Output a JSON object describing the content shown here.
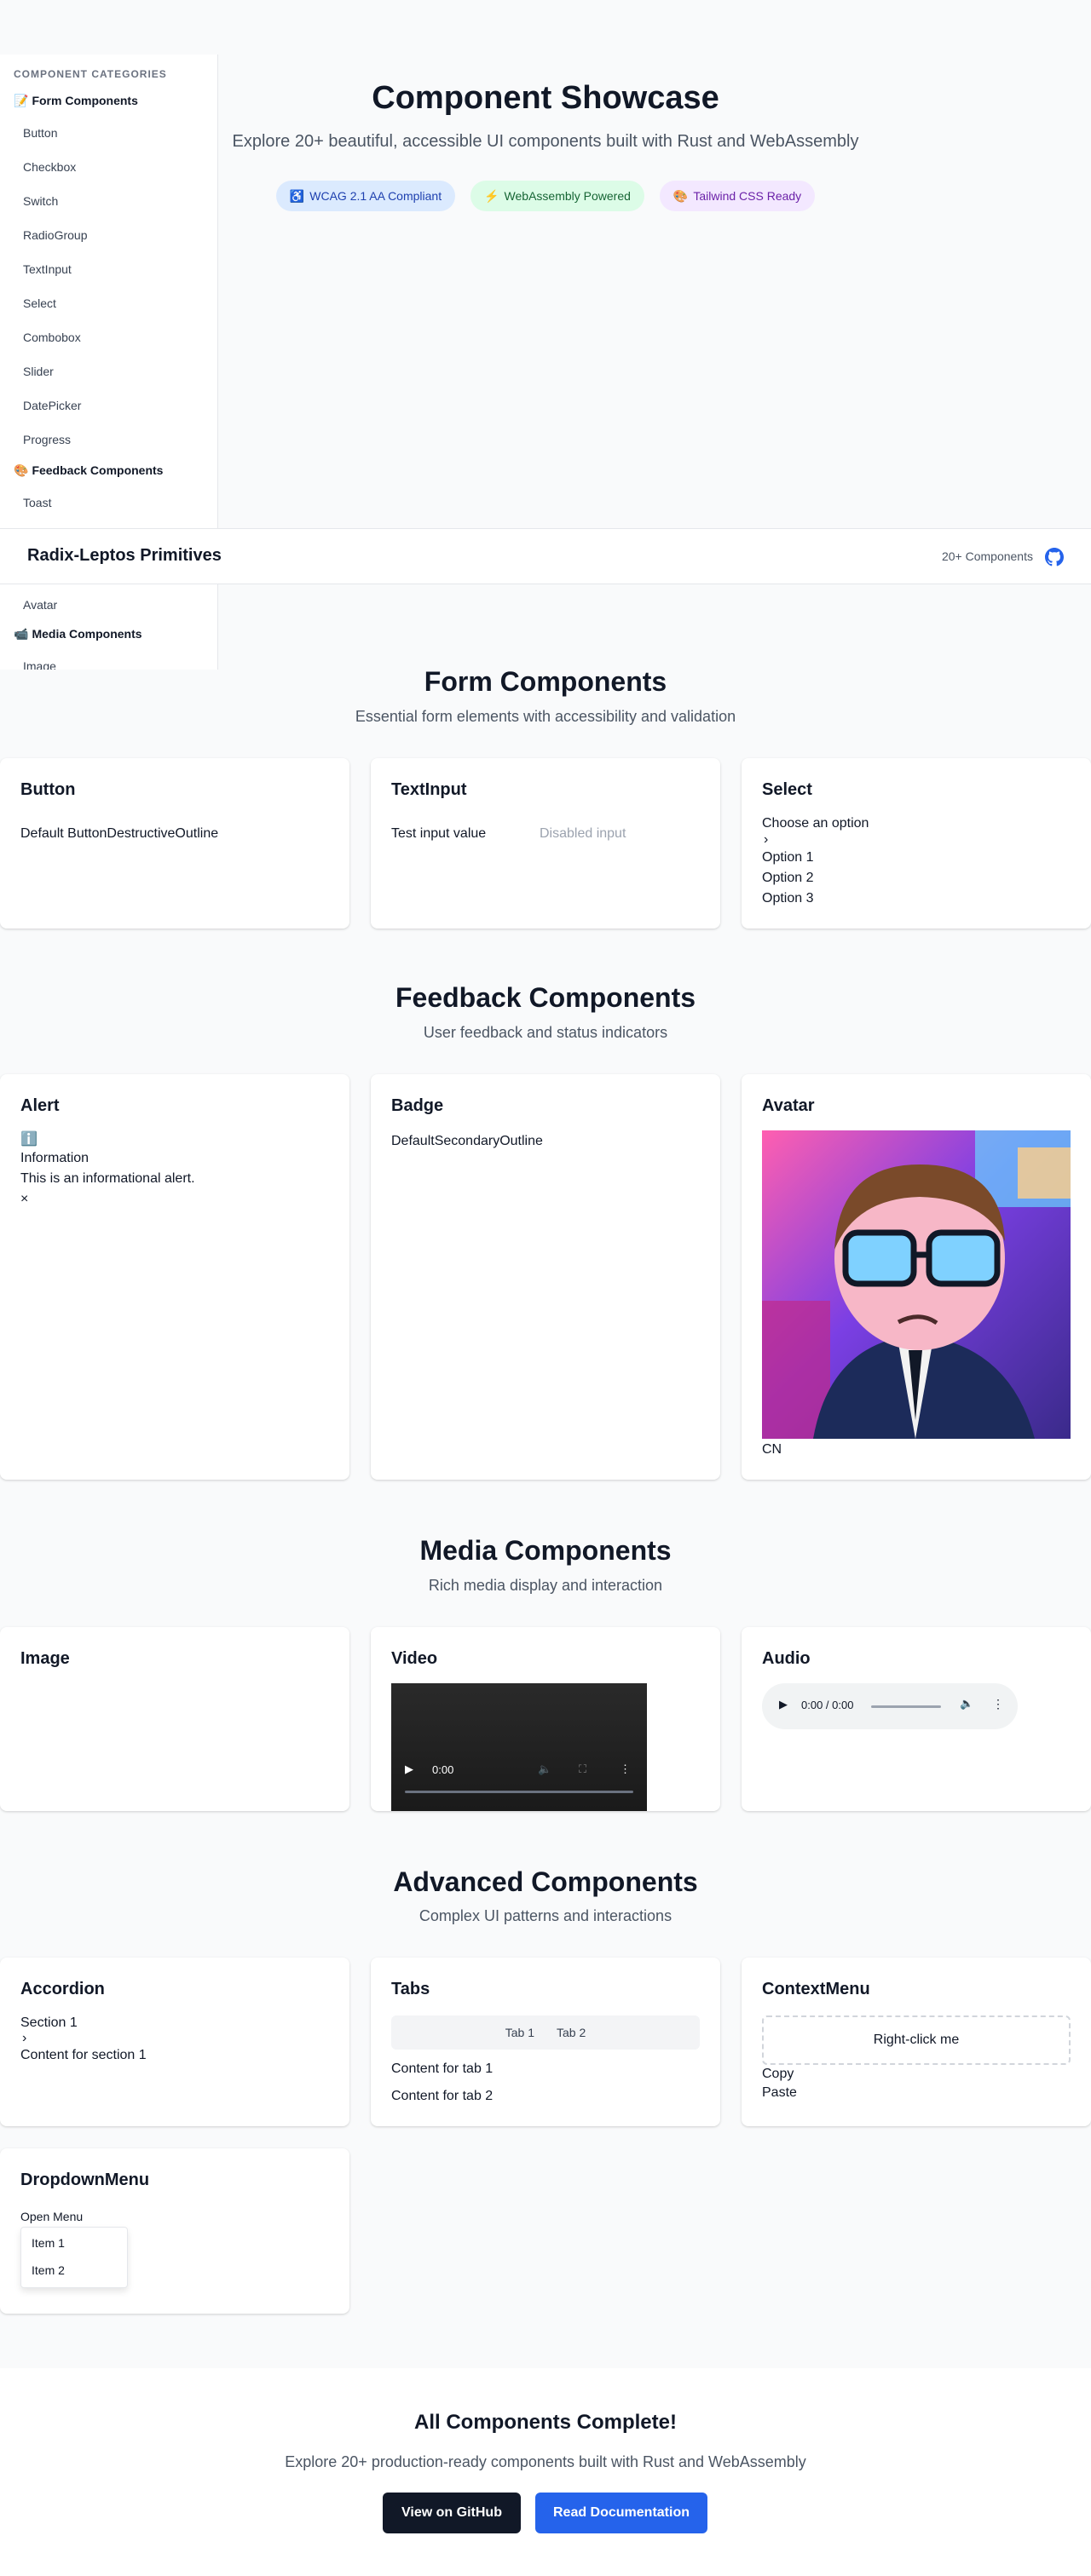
{
  "sidebar": {
    "heading": "COMPONENT CATEGORIES",
    "form_category": {
      "emoji": "📝",
      "label": "Form Components"
    },
    "form_items": [
      "Button",
      "Checkbox",
      "Switch",
      "RadioGroup",
      "TextInput",
      "Select",
      "Combobox",
      "Slider",
      "DatePicker",
      "Progress"
    ],
    "feedback_category": {
      "emoji": "🎨",
      "label": "Feedback Components"
    },
    "feedback_items": [
      "Toast",
      "Avatar"
    ],
    "media_category": {
      "emoji": "📹",
      "label": "Media Components"
    },
    "media_items": [
      "Image"
    ]
  },
  "header": {
    "brand": "Radix-Leptos Primitives",
    "count": "20+ Components",
    "github_icon": "github-icon"
  },
  "hero": {
    "title": "Component Showcase",
    "subtitle": "Explore 20+ beautiful, accessible UI components built with Rust and WebAssembly",
    "badges": [
      {
        "emoji": "♿",
        "label": "WCAG 2.1 AA Compliant",
        "color": "#dbeafe"
      },
      {
        "emoji": "⚡",
        "label": "WebAssembly Powered",
        "color": "#dcfce7"
      },
      {
        "emoji": "🎨",
        "label": "Tailwind CSS Ready",
        "color": "#f3e8ff"
      }
    ]
  },
  "form_section": {
    "title": "Form Components",
    "subtitle": "Essential form elements with accessibility and validation",
    "button_card": {
      "title": "Button",
      "content": "Default ButtonDestructiveOutline"
    },
    "textinput_card": {
      "title": "TextInput",
      "value": "Test input value",
      "disabled_placeholder": "Disabled input"
    },
    "select_card": {
      "title": "Select",
      "placeholder": "Choose an option",
      "chevron": "›",
      "options": [
        "Option 1",
        "Option 2",
        "Option 3"
      ]
    }
  },
  "feedback_section": {
    "title": "Feedback Components",
    "subtitle": "User feedback and status indicators",
    "alert_card": {
      "title": "Alert",
      "icon": "ℹ️",
      "heading": "Information",
      "message": "This is an informational alert.",
      "close": "×"
    },
    "badge_card": {
      "title": "Badge",
      "content": "DefaultSecondaryOutline"
    },
    "avatar_card": {
      "title": "Avatar",
      "fallback": "CN"
    }
  },
  "media_section": {
    "title": "Media Components",
    "subtitle": "Rich media display and interaction",
    "image_card": {
      "title": "Image"
    },
    "video_card": {
      "title": "Video",
      "time": "0:00"
    },
    "audio_card": {
      "title": "Audio",
      "time": "0:00 / 0:00"
    }
  },
  "advanced_section": {
    "title": "Advanced Components",
    "subtitle": "Complex UI patterns and interactions",
    "accordion_card": {
      "title": "Accordion",
      "section": "Section 1",
      "chevron": "›",
      "content": "Content for section 1"
    },
    "tabs_card": {
      "title": "Tabs",
      "tabs": [
        "Tab 1",
        "Tab 2"
      ],
      "contents": [
        "Content for tab 1",
        "Content for tab 2"
      ]
    },
    "contextmenu_card": {
      "title": "ContextMenu",
      "trigger": "Right-click me",
      "items": [
        "Copy",
        "Paste"
      ]
    },
    "dropdown_card": {
      "title": "DropdownMenu",
      "trigger": "Open Menu",
      "items": [
        "Item 1",
        "Item 2"
      ]
    }
  },
  "final": {
    "title": "All Components Complete!",
    "subtitle": "Explore 20+ production-ready components built with Rust and WebAssembly",
    "github_button": "View on GitHub",
    "docs_button": "Read Documentation"
  }
}
